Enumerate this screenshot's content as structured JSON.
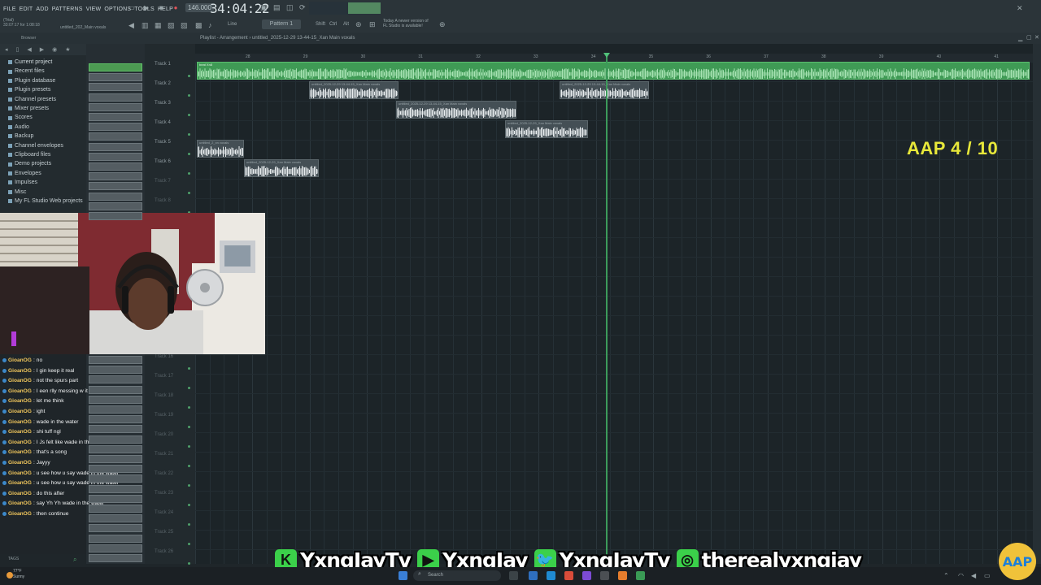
{
  "menu": [
    "FILE",
    "EDIT",
    "ADD",
    "PATTERNS",
    "VIEW",
    "OPTIONS",
    "TOOLS",
    "HELP"
  ],
  "transport": {
    "tempo": "146.000",
    "timecode": "34:04:22",
    "pattern": "Pattern 1",
    "snap": "Line",
    "shift": "Shift",
    "ctrl": "Ctrl",
    "alt": "Alt"
  },
  "info": {
    "line1": "(Trial)",
    "line2": "33:07:17 for 1:08:18",
    "project": "untitled_202_Main voxals"
  },
  "notification": {
    "line1": "Today A newer version of",
    "line2": "FL Studio is available!"
  },
  "browser": {
    "title": "Browser",
    "items": [
      "Current project",
      "Recent files",
      "Plugin database",
      "Plugin presets",
      "Channel presets",
      "Mixer presets",
      "Scores",
      "Audio",
      "Backup",
      "Channel envelopes",
      "Clipboard files",
      "Demo projects",
      "Envelopes",
      "Impulses",
      "Misc",
      "My FL Studio Web projects"
    ]
  },
  "playlist": {
    "title": "Playlist - Arrangement",
    "file": "untitled_2025-12-29 13-44-15_Xan Main voxals",
    "ruler": [
      "28",
      "29",
      "30",
      "31",
      "32",
      "33",
      "34",
      "35",
      "36",
      "37",
      "38",
      "39",
      "40",
      "41",
      "42",
      "43"
    ],
    "tracks_top": [
      "Track 1",
      "Track 2",
      "Track 3",
      "Track 4",
      "Track 5",
      "Track 6",
      "Track 7",
      "Track 8"
    ],
    "tracks_bottom": [
      "Track 16",
      "Track 17",
      "Track 18",
      "Track 19",
      "Track 20",
      "Track 21",
      "Track 22",
      "Track 23",
      "Track 24",
      "Track 25",
      "Track 26"
    ],
    "clips": {
      "beat": "beat Xn8",
      "main": "untitled_2025-12-29 13-44-15_Xan Main voxals",
      "adlib": "untitled_2025-12-29_Xan Main voxals",
      "dub": "untitled_2_xn voxals"
    }
  },
  "counter": "AAP 4 / 10",
  "chat": [
    {
      "user": "GioanOG",
      "msg": "no"
    },
    {
      "user": "GioanOG",
      "msg": "I gin keep it real"
    },
    {
      "user": "GioanOG",
      "msg": "not the spurs part"
    },
    {
      "user": "GioanOG",
      "msg": "I een rlly messing w it"
    },
    {
      "user": "GioanOG",
      "msg": "let me think"
    },
    {
      "user": "GioanOG",
      "msg": "ight"
    },
    {
      "user": "GioanOG",
      "msg": "wade in the water"
    },
    {
      "user": "GioanOG",
      "msg": "shi tuff ngl"
    },
    {
      "user": "GioanOG",
      "msg": "I Js felt like wade in the water"
    },
    {
      "user": "GioanOG",
      "msg": "that's a song"
    },
    {
      "user": "GioanOG",
      "msg": "Jayyy"
    },
    {
      "user": "GioanOG",
      "msg": "u see how u say wade in the water"
    },
    {
      "user": "GioanOG",
      "msg": "u see how u say wade in the water"
    },
    {
      "user": "GioanOG",
      "msg": "do this after"
    },
    {
      "user": "GioanOG",
      "msg": "say Yh Yh wade in the water"
    },
    {
      "user": "GioanOG",
      "msg": "then continue"
    }
  ],
  "tags": "TAGS",
  "socials": [
    {
      "icon": "K",
      "name": "YxngJayTv",
      "color": "#3bd04a"
    },
    {
      "icon": "▶",
      "name": "YxngJay",
      "color": "#3bd04a"
    },
    {
      "icon": "🐦",
      "name": "YxngJayTv",
      "color": "#3bd04a"
    },
    {
      "icon": "◎",
      "name": "therealyxngjay",
      "color": "#3bd04a"
    }
  ],
  "taskbar": {
    "temp": "77°F",
    "weather": "Sunny",
    "search": "Search"
  },
  "logo": "AAP",
  "colors": {
    "accent_green": "#3f9a55",
    "counter_yellow": "#e8e83a",
    "playhead": "#3c9a5a"
  }
}
